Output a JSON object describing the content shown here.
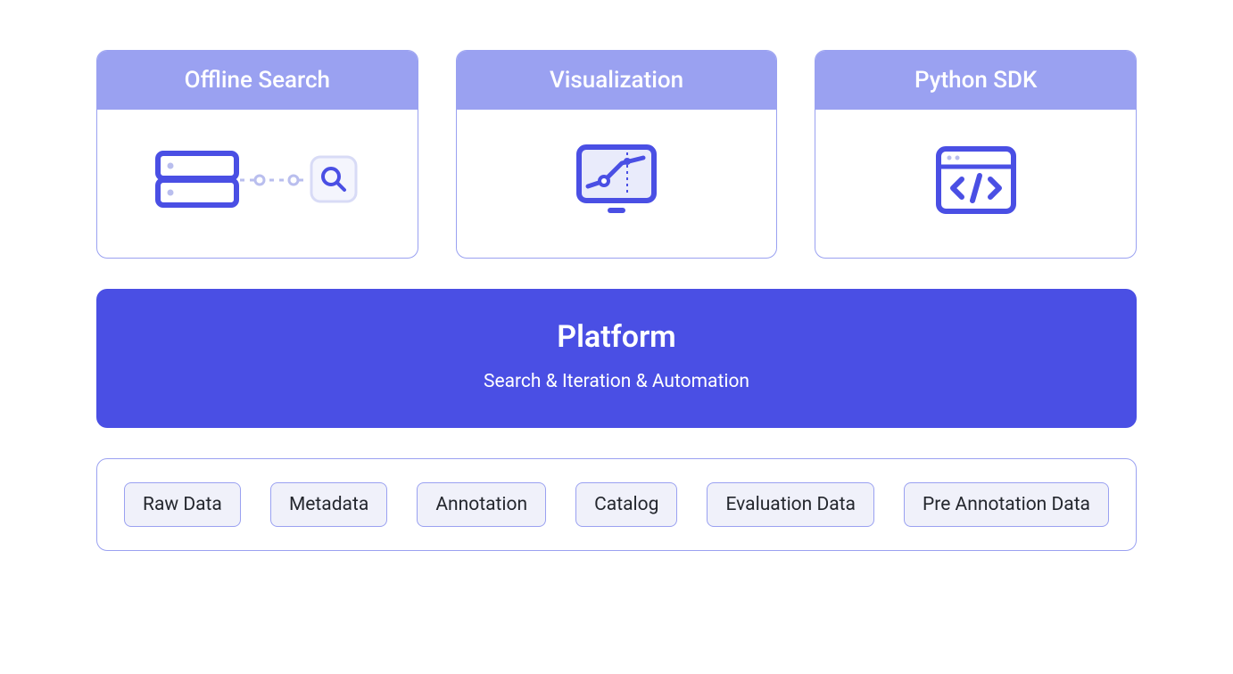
{
  "cards": [
    {
      "title": "Offline Search",
      "icon": "database-search-icon"
    },
    {
      "title": "Visualization",
      "icon": "chart-monitor-icon"
    },
    {
      "title": "Python SDK",
      "icon": "code-window-icon"
    }
  ],
  "platform": {
    "title": "Platform",
    "subtitle": "Search & Iteration & Automation"
  },
  "data_items": [
    "Raw Data",
    "Metadata",
    "Annotation",
    "Catalog",
    "Evaluation Data",
    "Pre Annotation Data"
  ],
  "colors": {
    "light_purple": "#9aa1f1",
    "deep_purple": "#4a4fe4",
    "chip_bg": "#f0f1fa"
  }
}
